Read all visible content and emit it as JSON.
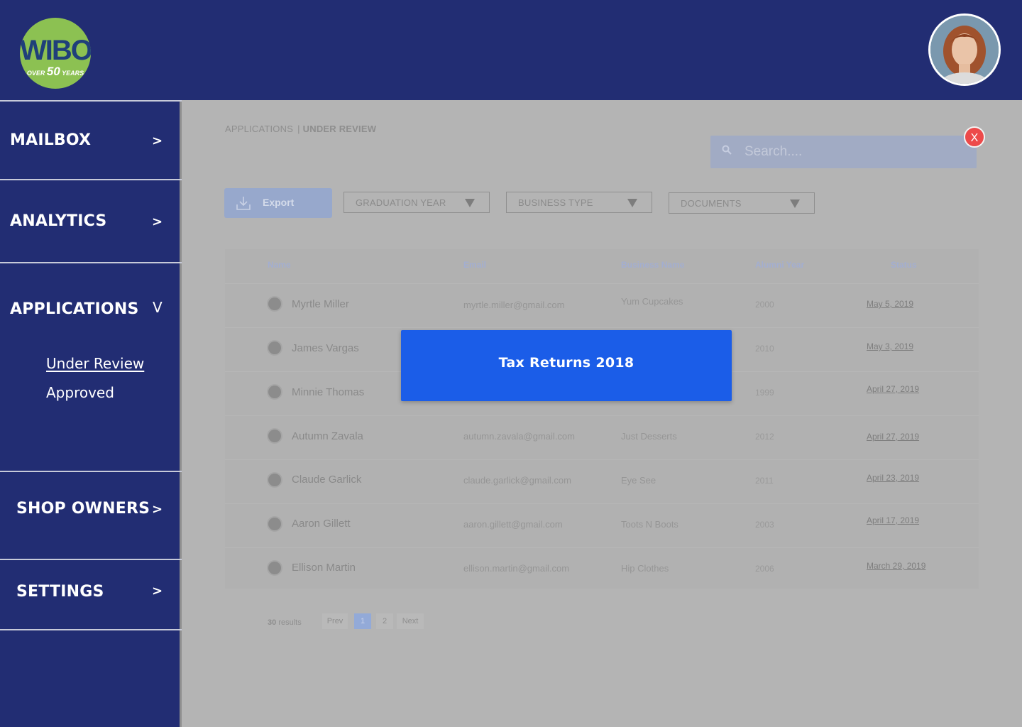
{
  "brand": {
    "logo_text": "WIBO",
    "logo_tagline_pre": "OVER",
    "logo_tagline_num": "50",
    "logo_tagline_post": "YEARS"
  },
  "sidebar": {
    "sections": [
      {
        "label": "MAILBOX",
        "arrow": ">"
      },
      {
        "label": "ANALYTICS",
        "arrow": ">"
      },
      {
        "label": "APPLICATIONS",
        "arrow": "V",
        "subitems": [
          {
            "label": "Under Review",
            "active": true
          },
          {
            "label": "Approved",
            "active": false
          }
        ]
      },
      {
        "label": "SHOP OWNERS",
        "arrow": ">"
      },
      {
        "label": "SETTINGS",
        "arrow": ">"
      }
    ]
  },
  "breadcrumb": {
    "root": "APPLICATIONS",
    "separator": "|",
    "current": "UNDER REVIEW"
  },
  "search": {
    "placeholder": "Search...."
  },
  "close_label": "X",
  "toolbar": {
    "export_label": "Export",
    "filters": [
      "GRADUATION YEAR",
      "BUSINESS TYPE",
      "DOCUMENTS"
    ]
  },
  "table": {
    "columns": [
      "Name",
      "Email",
      "Business Name",
      "Alumni Year",
      "Status"
    ],
    "rows": [
      {
        "name": "Myrtle Miller",
        "email": "myrtle.miller@gmail.com",
        "business": "Yum Cupcakes",
        "year": "2000",
        "status": "May 5, 2019"
      },
      {
        "name": "James Vargas",
        "email": "",
        "business": "",
        "year": "2010",
        "status": "May 3, 2019"
      },
      {
        "name": "Minnie Thomas",
        "email": "",
        "business": "",
        "year": "1999",
        "status": "April 27, 2019"
      },
      {
        "name": "Autumn Zavala",
        "email": "autumn.zavala@gmail.com",
        "business": "Just Desserts",
        "year": "2012",
        "status": "April 27, 2019"
      },
      {
        "name": "Claude Garlick",
        "email": "claude.garlick@gmail.com",
        "business": "Eye See",
        "year": "2011",
        "status": "April 23, 2019"
      },
      {
        "name": "Aaron Gillett",
        "email": "aaron.gillett@gmail.com",
        "business": "Toots N Boots",
        "year": "2003",
        "status": "April 17, 2019"
      },
      {
        "name": "Ellison Martin",
        "email": "ellison.martin@gmail.com",
        "business": "Hip Clothes",
        "year": "2006",
        "status": "March 29, 2019"
      }
    ]
  },
  "pagination": {
    "results_count": "30",
    "results_label": "results",
    "prev": "Prev",
    "pages": [
      "1",
      "2"
    ],
    "current_page": "1",
    "next": "Next"
  },
  "modal": {
    "title": "Tax Returns 2018"
  },
  "colors": {
    "header_bg": "#222d73",
    "modal_bg": "#1b5de8",
    "close_bg": "#ed4a4a",
    "logo_green": "#8cc152",
    "overlay": "#b4b4b4"
  }
}
